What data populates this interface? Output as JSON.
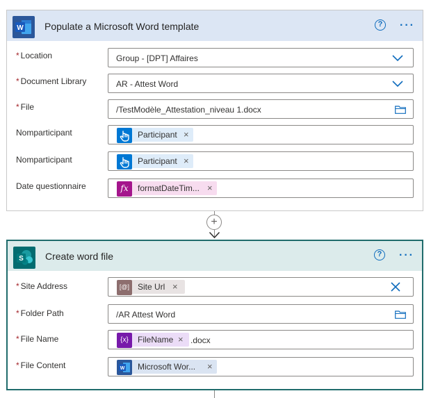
{
  "step1": {
    "title": "Populate a Microsoft Word template",
    "help": "?",
    "more": "···",
    "fields": [
      {
        "label": "Location",
        "required": true,
        "value": "Group - [DPT] Affaires"
      },
      {
        "label": "Document Library",
        "required": true,
        "value": "AR - Attest Word"
      },
      {
        "label": "File",
        "required": true,
        "value": "/TestModèle_Attestation_niveau 1.docx"
      },
      {
        "label": "Nomparticipant",
        "required": false,
        "token": "Participant"
      },
      {
        "label": "Nomparticipant",
        "required": false,
        "token": "Participant"
      },
      {
        "label": "Date questionnaire",
        "required": false,
        "token": "formatDateTim...",
        "token_icon": "fx"
      }
    ]
  },
  "connector": {
    "add": "+"
  },
  "step2": {
    "title": "Create word file",
    "help": "?",
    "more": "···",
    "fields": [
      {
        "label": "Site Address",
        "required": true,
        "token": "Site Url",
        "token_icon": "[@]"
      },
      {
        "label": "Folder Path",
        "required": true,
        "value": "/AR  Attest Word"
      },
      {
        "label": "File Name",
        "required": true,
        "token": "FileName",
        "token_icon": "{x}",
        "suffix": ".docx"
      },
      {
        "label": "File Content",
        "required": true,
        "token": "Microsoft Wor..."
      }
    ]
  },
  "colors": {
    "word_header": "#dce6f4",
    "sp_header": "#dcebeb",
    "accent": "#0f6cbd",
    "required": "#a4262c"
  }
}
